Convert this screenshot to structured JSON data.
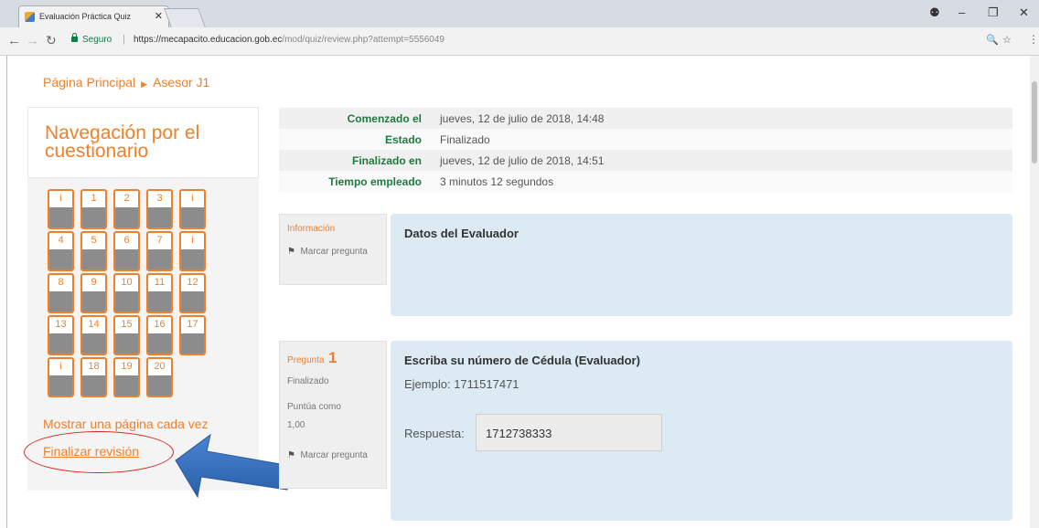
{
  "browser": {
    "tab_title": "Evaluación Práctica Quiz",
    "tab_close": "✕",
    "secure_label": "Seguro",
    "url_host": "https://mecapacito.educacion.gob.ec",
    "url_path": "/mod/quiz/review.php?attempt=5556049"
  },
  "breadcrumb": {
    "home": "Página Principal",
    "current": "Asesor J1"
  },
  "sidebar": {
    "title": "Navegación por el cuestionario",
    "questions": [
      "i",
      "1",
      "2",
      "3",
      "i",
      "4",
      "5",
      "6",
      "7",
      "i",
      "8",
      "9",
      "10",
      "11",
      "12",
      "13",
      "14",
      "15",
      "16",
      "17",
      "i",
      "18",
      "19",
      "20"
    ],
    "show_one_page": "Mostrar una página cada vez",
    "finish_review": "Finalizar revisión"
  },
  "summary": [
    {
      "label": "Comenzado el",
      "value": "jueves, 12 de julio de 2018, 14:48"
    },
    {
      "label": "Estado",
      "value": "Finalizado"
    },
    {
      "label": "Finalizado en",
      "value": "jueves, 12 de julio de 2018, 14:51"
    },
    {
      "label": "Tiempo empleado",
      "value": "3 minutos 12 segundos"
    }
  ],
  "info_block": {
    "label": "Información",
    "flag": "Marcar pregunta",
    "title": "Datos del Evaluador"
  },
  "question1": {
    "label": "Pregunta",
    "number": "1",
    "status": "Finalizado",
    "score_label": "Puntúa como",
    "score": "1,00",
    "flag": "Marcar pregunta",
    "title": "Escriba su número de Cédula (Evaluador)",
    "example": "Ejemplo: 1711517471",
    "answer_label": "Respuesta:",
    "answer_value": "1712738333"
  }
}
